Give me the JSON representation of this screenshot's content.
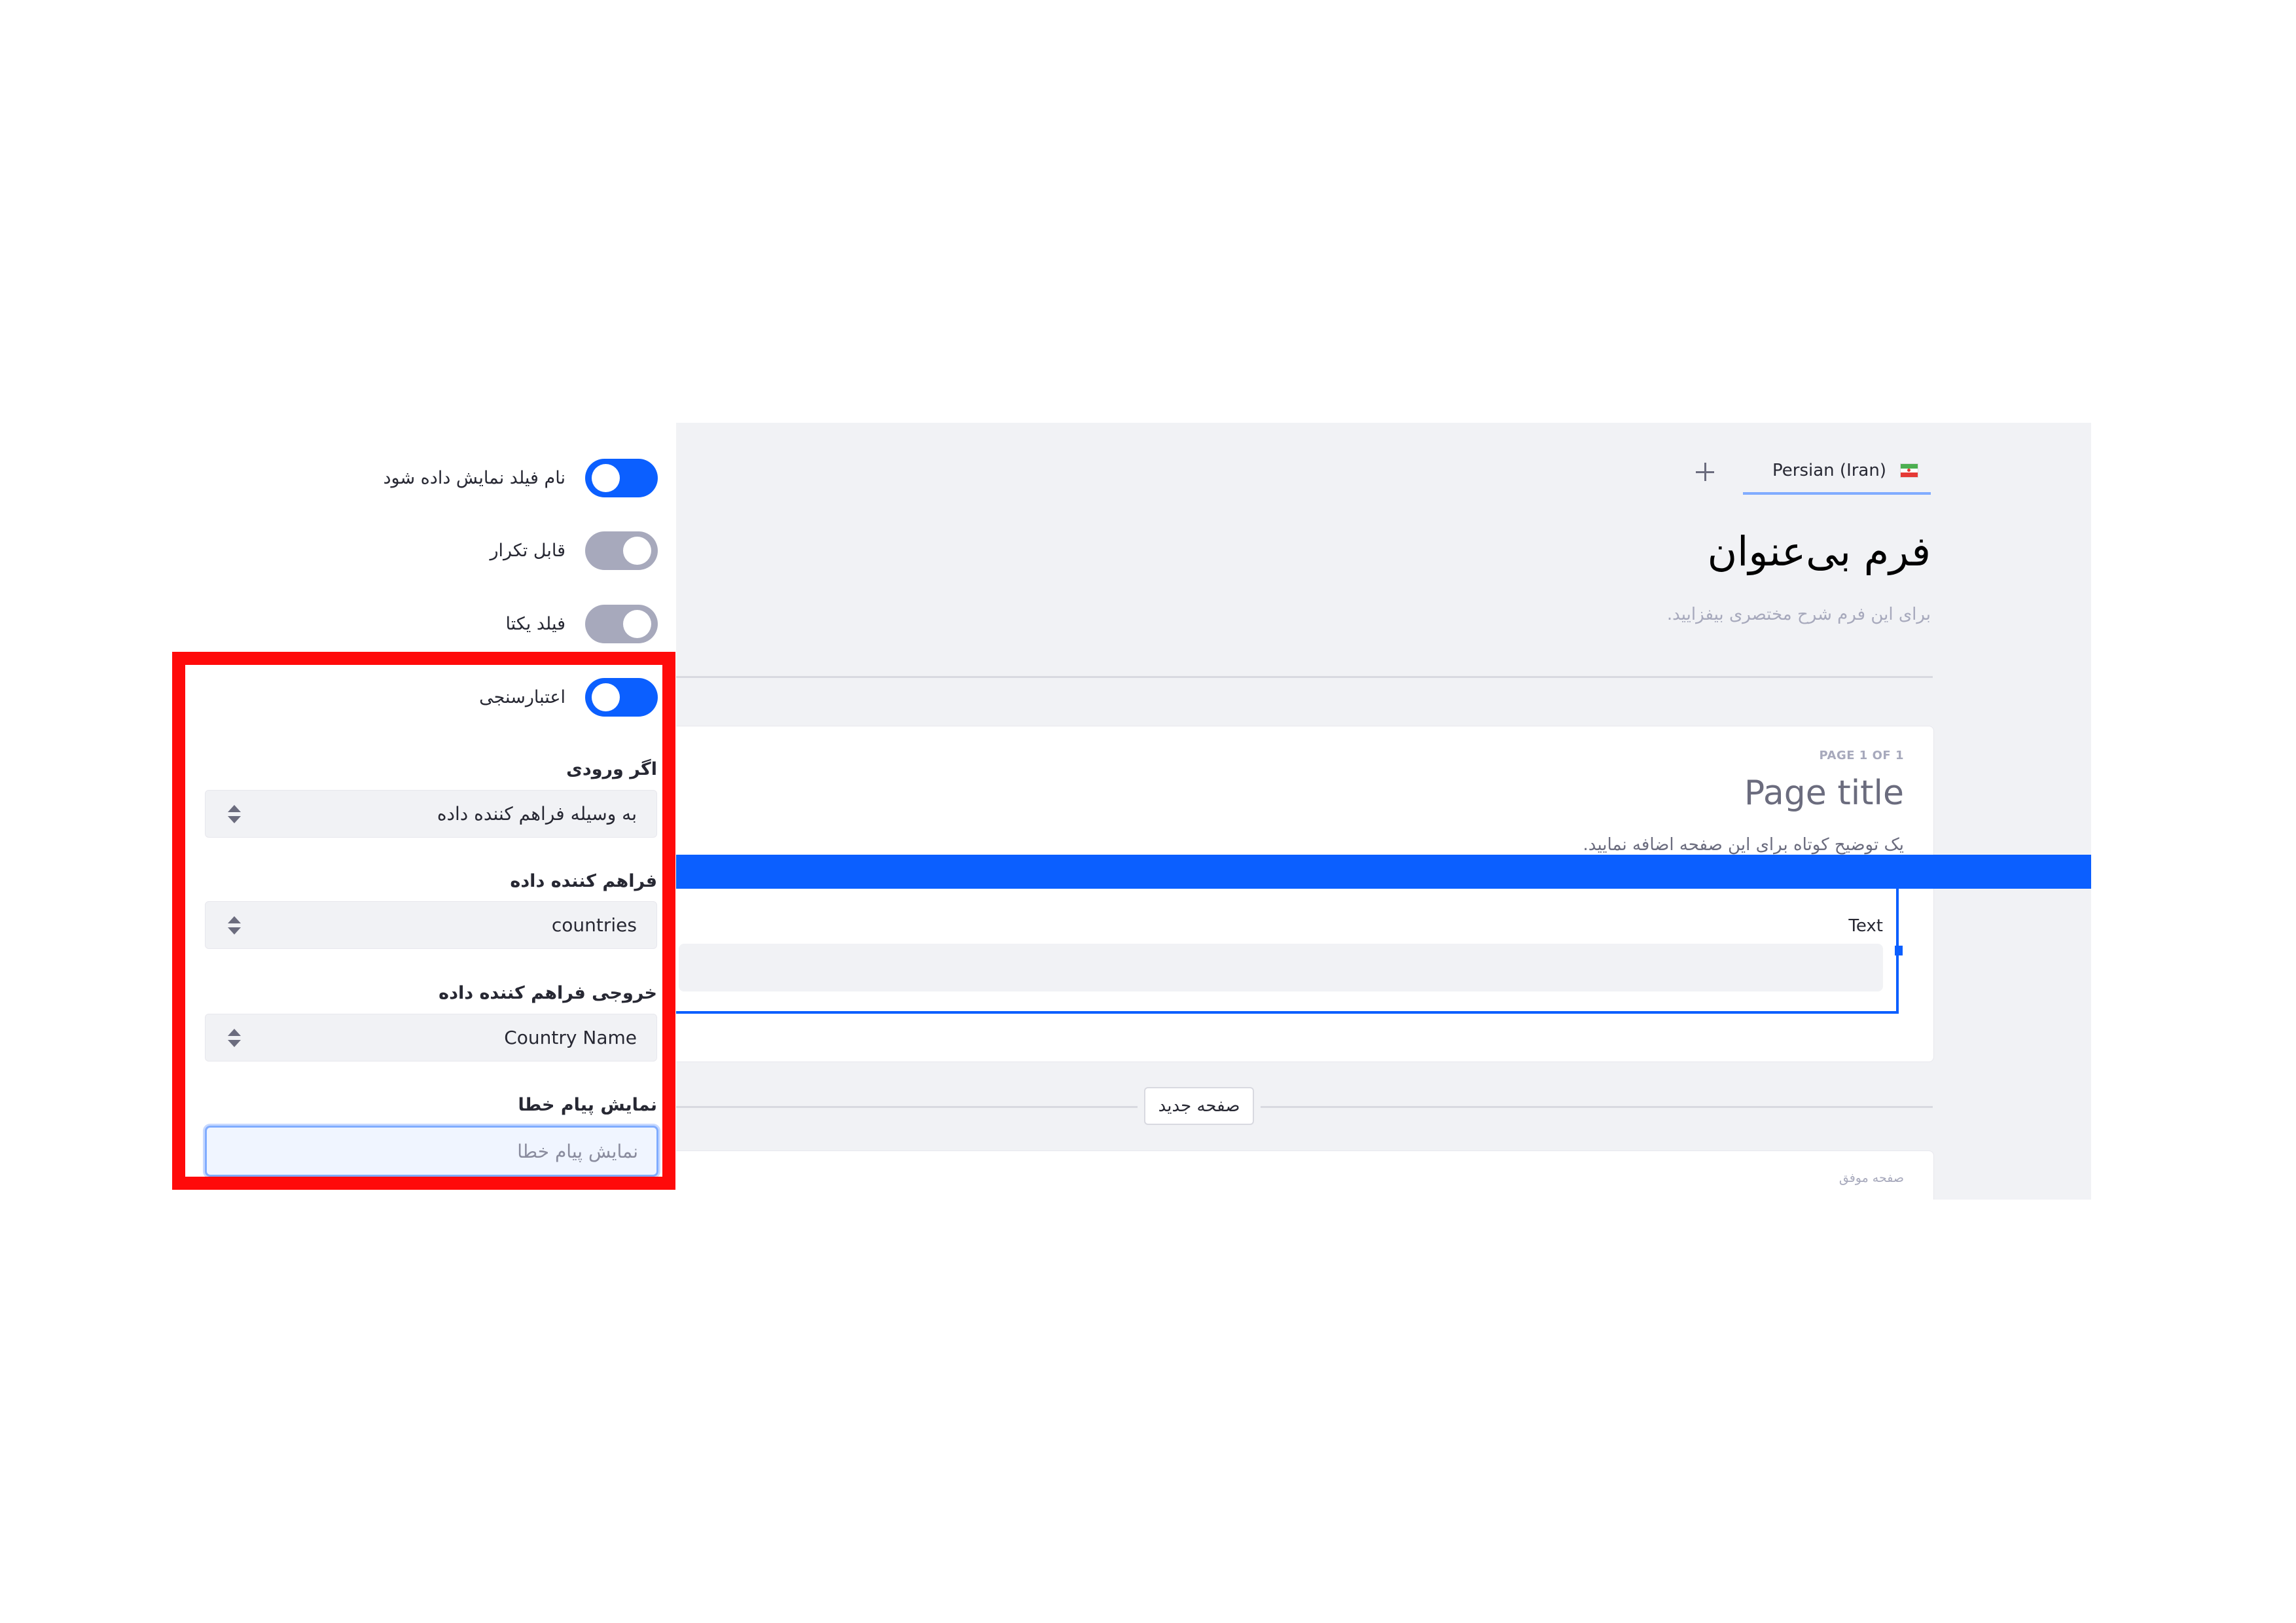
{
  "canvas": {
    "language_tab": {
      "label": "Persian (Iran)",
      "flag_icon": "iran-flag-icon",
      "add_icon": "plus-icon"
    },
    "form_title": "فرم بی‌عنوان",
    "form_description_placeholder": "برای این فرم شرح مختصری بیفزایید.",
    "page": {
      "counter": "PAGE 1 OF 1",
      "title": "Page title",
      "description": "یک توضیح کوتاه برای این صفحه اضافه نمایید."
    },
    "field": {
      "label": "Text"
    },
    "new_page_button": "صفحه جدید",
    "success_page_label": "صفحه موفق",
    "colors": {
      "accent": "#0b5fff",
      "canvas_bg": "#f1f2f5",
      "highlight": "#ff0a0a"
    }
  },
  "sidebar": {
    "toggles": [
      {
        "label": "نام فیلد نمایش داده شود",
        "on": true
      },
      {
        "label": "قابل تکرار",
        "on": false
      },
      {
        "label": "فیلد یکتا",
        "on": false
      },
      {
        "label": "اعتبارسنجی",
        "on": true
      }
    ],
    "validation": {
      "if_input_label": "اگر ورودی",
      "if_input_value": "به وسیله فراهم کننده داده",
      "data_provider_label": "فراهم کننده داده",
      "data_provider_value": "countries",
      "provider_output_label": "خروجی فراهم کننده داده",
      "provider_output_value": "Country Name",
      "error_message_label": "نمایش پیام خطا",
      "error_message_placeholder": "نمایش پیام خطا",
      "error_message_value": ""
    }
  }
}
